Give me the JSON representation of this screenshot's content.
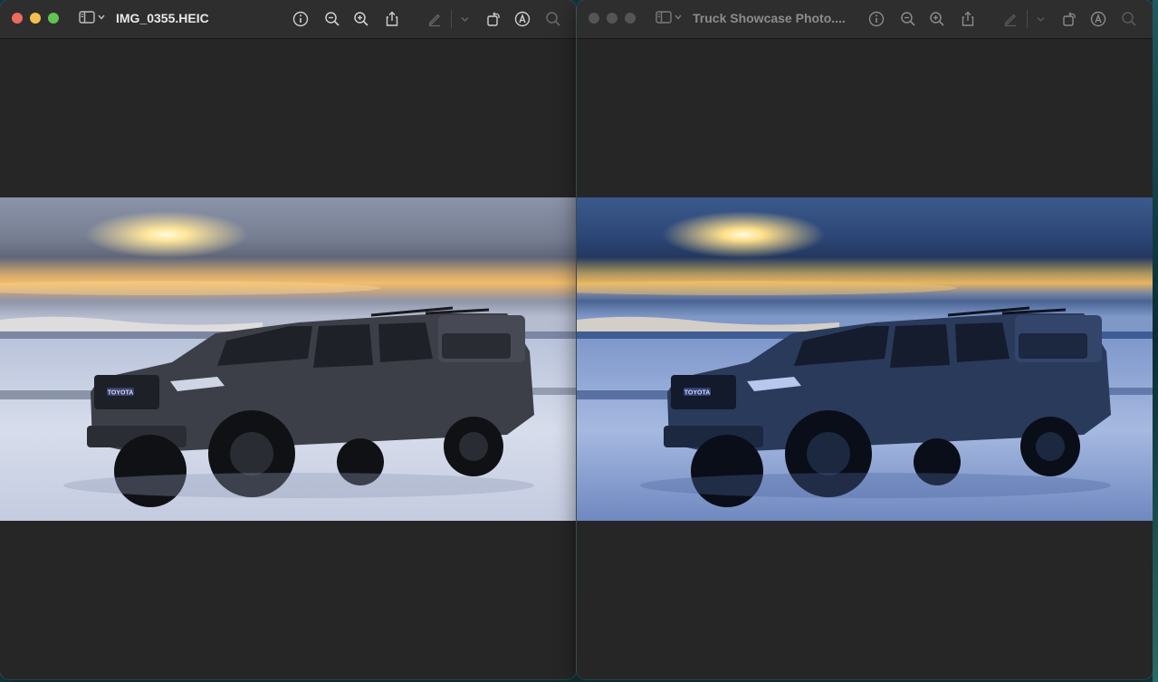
{
  "windows": [
    {
      "id": "left",
      "title": "IMG_0355.HEIC",
      "active": true,
      "photo": {
        "variant": "natural"
      }
    },
    {
      "id": "right",
      "title": "Truck Showcase Photo....",
      "active": false,
      "photo": {
        "variant": "blue-tint"
      }
    }
  ],
  "toolbar_icons": [
    "sidebar-icon",
    "chevron-down-icon",
    "info-icon",
    "zoom-out-icon",
    "zoom-in-icon",
    "share-icon",
    "markup-pen-icon",
    "chevron-down-icon",
    "rotate-icon",
    "markup-icon",
    "search-icon"
  ],
  "photo_text": {
    "grille_badge": "TOYOTA"
  },
  "colors": {
    "window_bg": "#262626",
    "titlebar_bg": "#2e2e2e",
    "close": "#ed6a5e",
    "minimize": "#f4bf4f",
    "zoom": "#61c554"
  }
}
